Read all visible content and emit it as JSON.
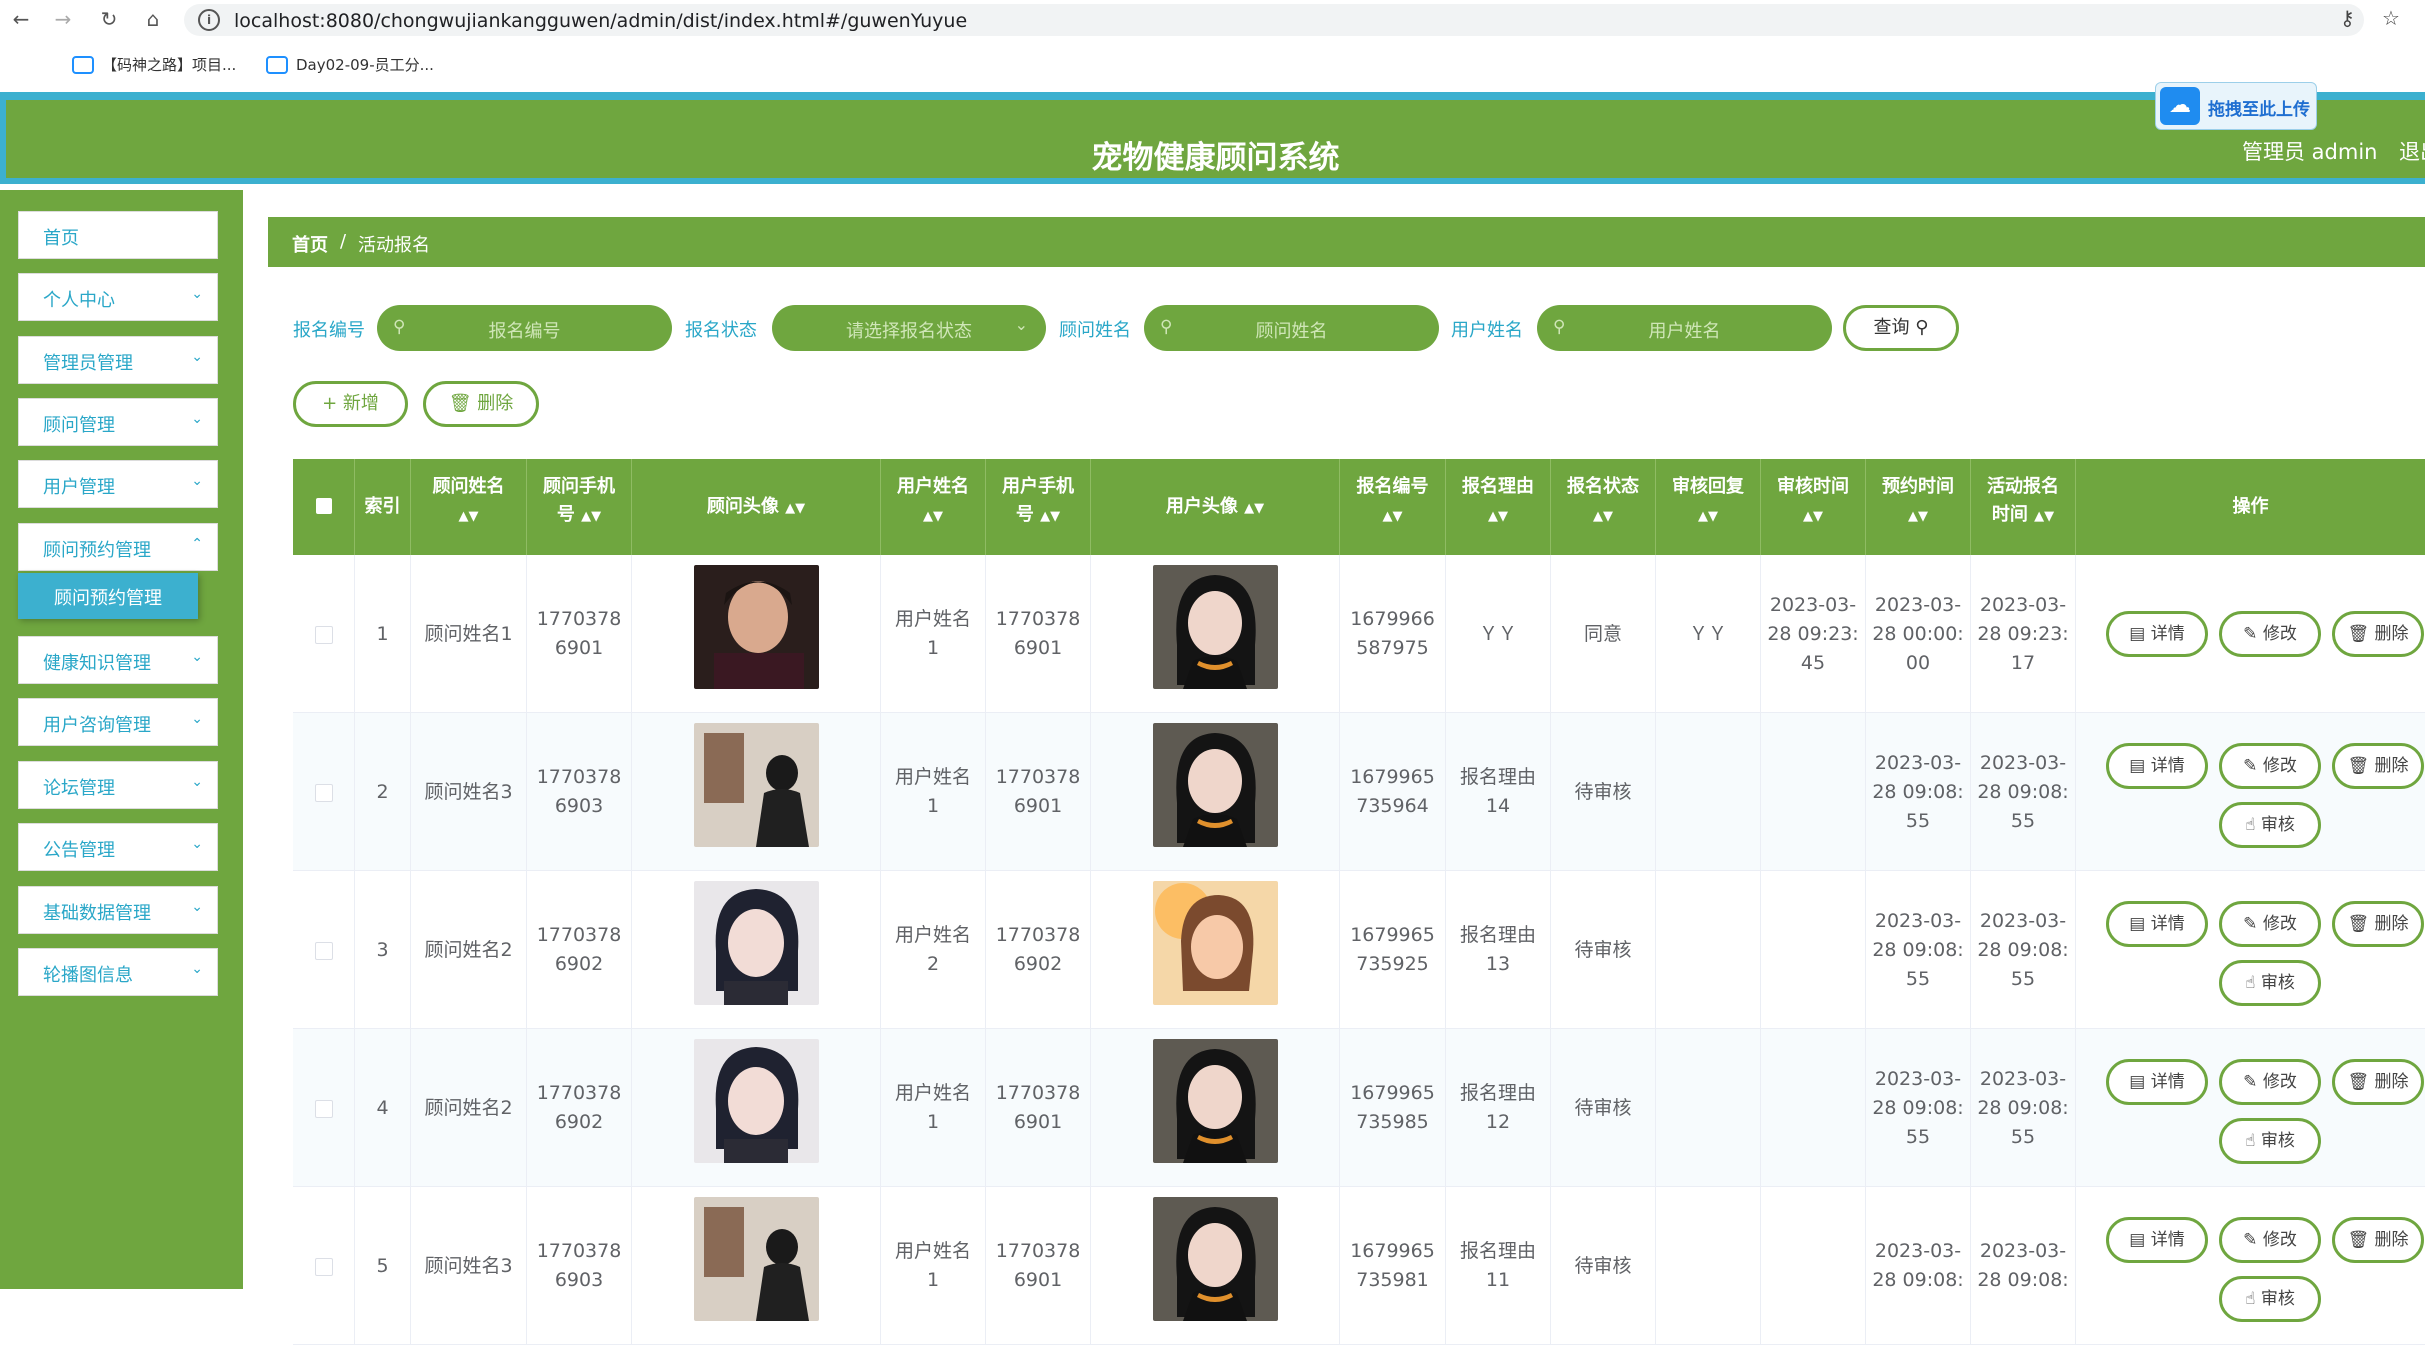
{
  "browser": {
    "url": "localhost:8080/chongwujiankangguwen/admin/dist/index.html#/guwenYuyue",
    "bookmarks": [
      "【码神之路】项目...",
      "Day02-09-员工分..."
    ]
  },
  "header": {
    "title": "宠物健康顾问系统",
    "admin_label": "管理员 admin",
    "logout": "退出",
    "upload_button": "拖拽至此上传"
  },
  "sidebar": {
    "items": [
      {
        "label": "首页",
        "has_children": false
      },
      {
        "label": "个人中心",
        "has_children": true
      },
      {
        "label": "管理员管理",
        "has_children": true
      },
      {
        "label": "顾问管理",
        "has_children": true
      },
      {
        "label": "用户管理",
        "has_children": true
      },
      {
        "label": "顾问预约管理",
        "has_children": true,
        "expanded": true
      },
      {
        "label": "健康知识管理",
        "has_children": true
      },
      {
        "label": "用户咨询管理",
        "has_children": true
      },
      {
        "label": "论坛管理",
        "has_children": true
      },
      {
        "label": "公告管理",
        "has_children": true
      },
      {
        "label": "基础数据管理",
        "has_children": true
      },
      {
        "label": "轮播图信息",
        "has_children": true
      }
    ],
    "active_sub": "顾问预约管理"
  },
  "breadcrumb": {
    "home": "首页",
    "sep": "/",
    "current": "活动报名"
  },
  "filters": {
    "bianhao_label": "报名编号",
    "bianhao_placeholder": "报名编号",
    "status_label": "报名状态",
    "status_placeholder": "请选择报名状态",
    "guwen_label": "顾问姓名",
    "guwen_placeholder": "顾问姓名",
    "user_label": "用户姓名",
    "user_placeholder": "用户姓名",
    "query_button": "查询"
  },
  "actions": {
    "add": "新增",
    "delete": "删除"
  },
  "table": {
    "headers": {
      "index": "索引",
      "guwen_name": "顾问姓名",
      "guwen_phone_1": "顾问手机",
      "guwen_phone_2": "号",
      "guwen_avatar": "顾问头像",
      "user_name": "用户姓名",
      "user_phone_1": "用户手机",
      "user_phone_2": "号",
      "user_avatar": "用户头像",
      "bianhao": "报名编号",
      "reason": "报名理由",
      "status": "报名状态",
      "reply": "审核回复",
      "audit_time": "审核时间",
      "yuyue_time": "预约时间",
      "signup_time_1": "活动报名",
      "signup_time_2": "时间",
      "ops": "操作"
    },
    "op_labels": {
      "detail": "详情",
      "edit": "修改",
      "delete": "删除",
      "audit": "审核"
    },
    "rows": [
      {
        "index": "1",
        "guwen_name": "顾问姓名1",
        "guwen_phone": [
          "1770378",
          "6901"
        ],
        "user_name": [
          "用户姓名",
          "1"
        ],
        "user_phone": [
          "1770378",
          "6901"
        ],
        "bianhao": [
          "1679966",
          "587975"
        ],
        "reason": [
          "ＹＹ"
        ],
        "status": "同意",
        "reply": "ＹＹ",
        "audit_time": [
          "2023-03-",
          "28 09:23:",
          "45"
        ],
        "yuyue_time": [
          "2023-03-",
          "28 00:00:",
          "00"
        ],
        "signup_time": [
          "2023-03-",
          "28 09:23:",
          "17"
        ],
        "show_audit": false,
        "guwen_avatar_style": "man",
        "user_avatar_style": "girl-dark"
      },
      {
        "index": "2",
        "guwen_name": "顾问姓名3",
        "guwen_phone": [
          "1770378",
          "6903"
        ],
        "user_name": [
          "用户姓名",
          "1"
        ],
        "user_phone": [
          "1770378",
          "6901"
        ],
        "bianhao": [
          "1679965",
          "735964"
        ],
        "reason": [
          "报名理由",
          "14"
        ],
        "status": "待审核",
        "reply": "",
        "audit_time": [],
        "yuyue_time": [
          "2023-03-",
          "28 09:08:",
          "55"
        ],
        "signup_time": [
          "2023-03-",
          "28 09:08:",
          "55"
        ],
        "show_audit": true,
        "guwen_avatar_style": "back",
        "user_avatar_style": "girl-dark"
      },
      {
        "index": "3",
        "guwen_name": "顾问姓名2",
        "guwen_phone": [
          "1770378",
          "6902"
        ],
        "user_name": [
          "用户姓名",
          "2"
        ],
        "user_phone": [
          "1770378",
          "6902"
        ],
        "bianhao": [
          "1679965",
          "735925"
        ],
        "reason": [
          "报名理由",
          "13"
        ],
        "status": "待审核",
        "reply": "",
        "audit_time": [],
        "yuyue_time": [
          "2023-03-",
          "28 09:08:",
          "55"
        ],
        "signup_time": [
          "2023-03-",
          "28 09:08:",
          "55"
        ],
        "show_audit": true,
        "guwen_avatar_style": "girl-bob",
        "user_avatar_style": "girl-warm"
      },
      {
        "index": "4",
        "guwen_name": "顾问姓名2",
        "guwen_phone": [
          "1770378",
          "6902"
        ],
        "user_name": [
          "用户姓名",
          "1"
        ],
        "user_phone": [
          "1770378",
          "6901"
        ],
        "bianhao": [
          "1679965",
          "735985"
        ],
        "reason": [
          "报名理由",
          "12"
        ],
        "status": "待审核",
        "reply": "",
        "audit_time": [],
        "yuyue_time": [
          "2023-03-",
          "28 09:08:",
          "55"
        ],
        "signup_time": [
          "2023-03-",
          "28 09:08:",
          "55"
        ],
        "show_audit": true,
        "guwen_avatar_style": "girl-bob",
        "user_avatar_style": "girl-dark"
      },
      {
        "index": "5",
        "guwen_name": "顾问姓名3",
        "guwen_phone": [
          "1770378",
          "6903"
        ],
        "user_name": [
          "用户姓名",
          "1"
        ],
        "user_phone": [
          "1770378",
          "6901"
        ],
        "bianhao": [
          "1679965",
          "735981"
        ],
        "reason": [
          "报名理由",
          "11"
        ],
        "status": "待审核",
        "reply": "",
        "audit_time": [],
        "yuyue_time": [
          "2023-03-",
          "28 09:08:"
        ],
        "signup_time": [
          "2023-03-",
          "28 09:08:"
        ],
        "show_audit": true,
        "guwen_avatar_style": "back",
        "user_avatar_style": "girl-dark"
      }
    ]
  }
}
